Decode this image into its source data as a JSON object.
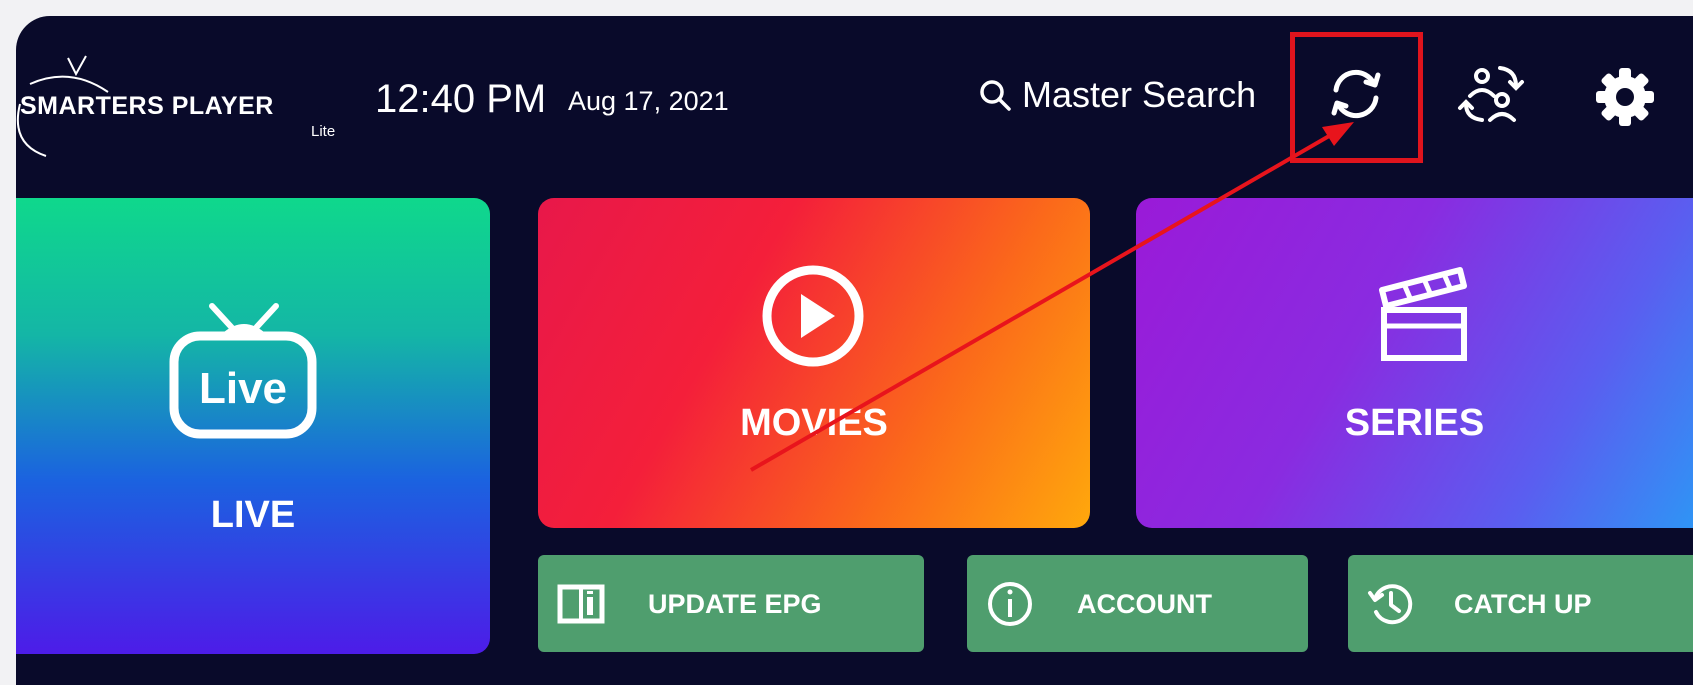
{
  "header": {
    "logo_title": "SMARTERS PLAYER",
    "logo_sub": "Lite",
    "time": "12:40 PM",
    "date": "Aug 17, 2021",
    "search_label": "Master Search"
  },
  "tiles": {
    "live": "LIVE",
    "live_badge": "Live",
    "movies": "MOVIES",
    "series": "SERIES"
  },
  "buttons": {
    "update_epg": "UPDATE EPG",
    "account": "ACCOUNT",
    "catch_up": "CATCH UP"
  },
  "icons": {
    "search": "search-icon",
    "refresh": "refresh-icon",
    "switch_user": "switch-user-icon",
    "settings": "gear-icon",
    "tv": "tv-icon",
    "play": "play-icon",
    "clapper": "clapperboard-icon",
    "book": "book-icon",
    "info": "info-icon",
    "history": "history-icon"
  },
  "colors": {
    "background": "#090a2a",
    "highlight": "#e0141d",
    "button_green": "#4f9e6e"
  }
}
